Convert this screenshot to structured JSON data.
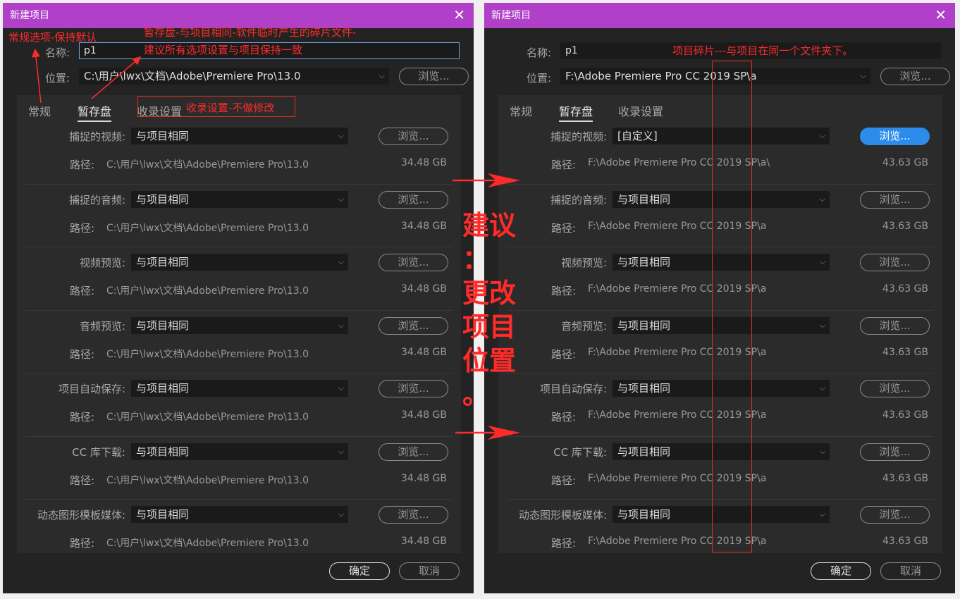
{
  "left": {
    "title": "新建项目",
    "name_label": "名称:",
    "name_value": "p1",
    "location_label": "位置:",
    "location_value": "C:\\用户\\lwx\\文档\\Adobe\\Premiere Pro\\13.0",
    "browse": "浏览...",
    "tabs": [
      "常规",
      "暂存盘",
      "收录设置"
    ],
    "active_tab": "暂存盘",
    "path_label": "路径:",
    "rows": [
      {
        "label": "捕捉的视频:",
        "value": "与项目相同",
        "path": "C:\\用户\\lwx\\文档\\Adobe\\Premiere Pro\\13.0",
        "size": "34.48 GB"
      },
      {
        "label": "捕捉的音频:",
        "value": "与项目相同",
        "path": "C:\\用户\\lwx\\文档\\Adobe\\Premiere Pro\\13.0",
        "size": "34.48 GB"
      },
      {
        "label": "视频预览:",
        "value": "与项目相同",
        "path": "C:\\用户\\lwx\\文档\\Adobe\\Premiere Pro\\13.0",
        "size": "34.48 GB"
      },
      {
        "label": "音频预览:",
        "value": "与项目相同",
        "path": "C:\\用户\\lwx\\文档\\Adobe\\Premiere Pro\\13.0",
        "size": "34.48 GB"
      },
      {
        "label": "项目自动保存:",
        "value": "与项目相同",
        "path": "C:\\用户\\lwx\\文档\\Adobe\\Premiere Pro\\13.0",
        "size": "34.48 GB"
      },
      {
        "label": "CC 库下载:",
        "value": "与项目相同",
        "path": "C:\\用户\\lwx\\文档\\Adobe\\Premiere Pro\\13.0",
        "size": "34.48 GB"
      },
      {
        "label": "动态图形模板媒体:",
        "value": "与项目相同",
        "path": "C:\\用户\\lwx\\文档\\Adobe\\Premiere Pro\\13.0",
        "size": "34.48 GB"
      }
    ],
    "ok": "确定",
    "cancel": "取消"
  },
  "right": {
    "title": "新建项目",
    "name_label": "名称:",
    "name_value": "p1",
    "location_label": "位置:",
    "location_value": "F:\\Adobe Premiere Pro CC 2019 SP\\a",
    "browse": "浏览...",
    "tabs": [
      "常规",
      "暂存盘",
      "收录设置"
    ],
    "active_tab": "暂存盘",
    "path_label": "路径:",
    "rows": [
      {
        "label": "捕捉的视频:",
        "value": "[自定义]",
        "path": "F:\\Adobe Premiere Pro CC 2019 SP\\a\\",
        "size": "43.63 GB",
        "highlight": true
      },
      {
        "label": "捕捉的音频:",
        "value": "与项目相同",
        "path": "F:\\Adobe Premiere Pro CC 2019 SP\\a",
        "size": "43.63 GB"
      },
      {
        "label": "视频预览:",
        "value": "与项目相同",
        "path": "F:\\Adobe Premiere Pro CC 2019 SP\\a",
        "size": "43.63 GB"
      },
      {
        "label": "音频预览:",
        "value": "与项目相同",
        "path": "F:\\Adobe Premiere Pro CC 2019 SP\\a",
        "size": "43.63 GB"
      },
      {
        "label": "项目自动保存:",
        "value": "与项目相同",
        "path": "F:\\Adobe Premiere Pro CC 2019 SP\\a",
        "size": "43.63 GB"
      },
      {
        "label": "CC 库下载:",
        "value": "与项目相同",
        "path": "F:\\Adobe Premiere Pro CC 2019 SP\\a",
        "size": "43.63 GB"
      },
      {
        "label": "动态图形模板媒体:",
        "value": "与项目相同",
        "path": "F:\\Adobe Premiere Pro CC 2019 SP\\a",
        "size": "43.63 GB"
      }
    ],
    "ok": "确定",
    "cancel": "取消"
  },
  "annotations": {
    "general": "常规选项-保持默认",
    "scratch_line1": "暂存盘-与项目相同-软件临时产生的碎片文件-",
    "scratch_line2": "建议所有选项设置与项目保持一致",
    "ingest": "收录设置-不做修改",
    "fragments": "项目碎片---与项目在同一个文件夹下。",
    "big_chars": [
      "建议",
      "：",
      "更改",
      "项目",
      "位置",
      "。"
    ],
    "color": "#ff2b2b"
  },
  "icons": {
    "close": "close-icon",
    "dropdown": "chevron-down-icon"
  }
}
